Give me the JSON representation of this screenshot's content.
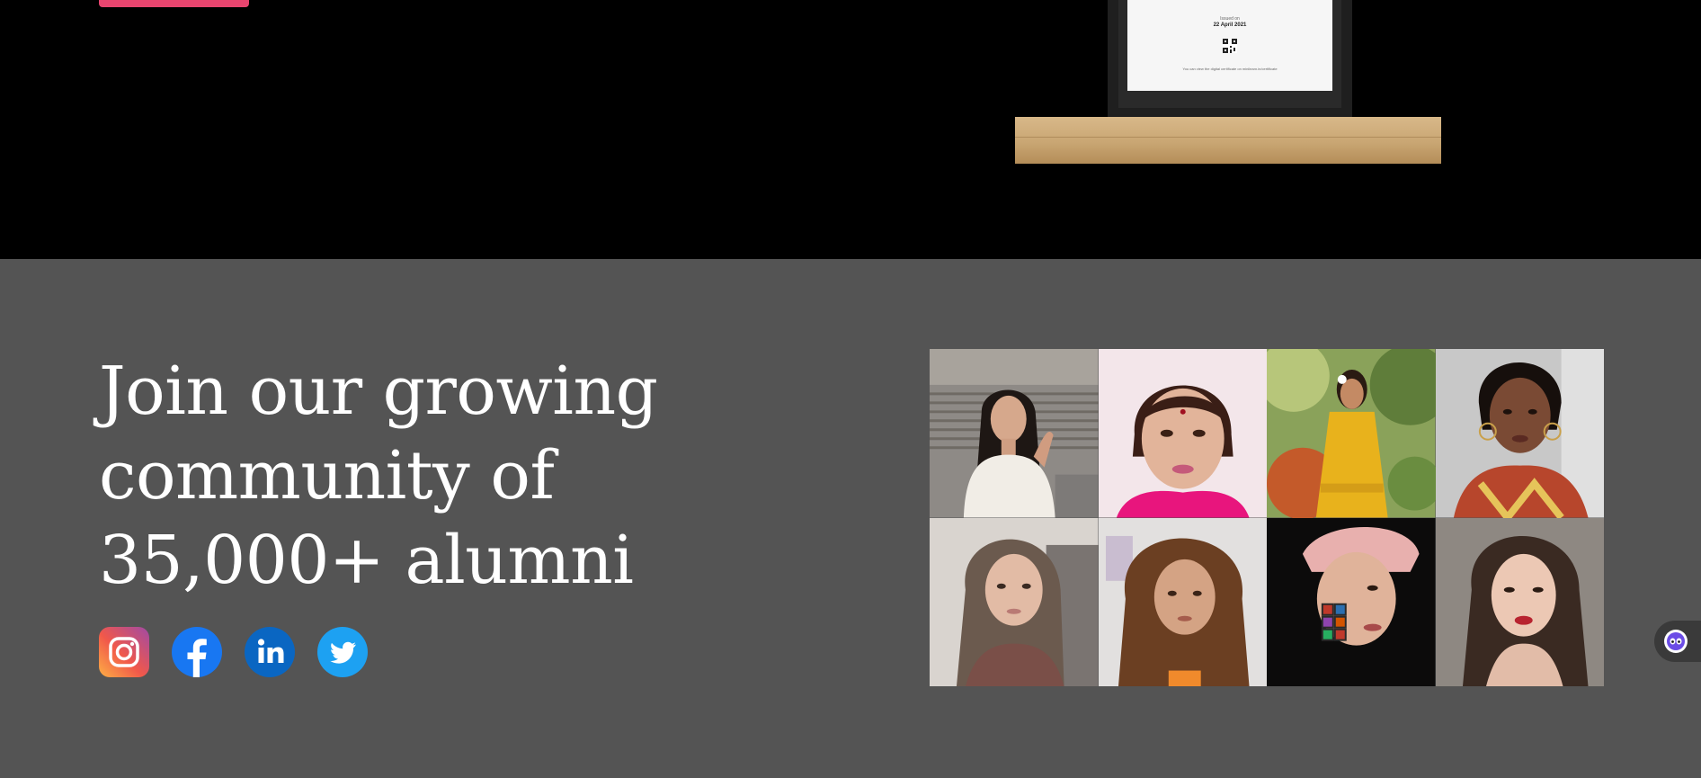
{
  "certificate": {
    "issued_label": "Issued on",
    "issued_date": "22 April 2021",
    "footer_text": "You can view the digital certificate on minilearn.in/certificate"
  },
  "community": {
    "heading_lines": [
      "Join our growing",
      "community of",
      "35,000+ alumni"
    ]
  },
  "social": [
    {
      "name": "instagram-icon",
      "color": "#d6249f"
    },
    {
      "name": "facebook-icon",
      "color": "#1877f2"
    },
    {
      "name": "linkedin-icon",
      "color": "#0a66c2"
    },
    {
      "name": "twitter-icon",
      "color": "#1da1f2"
    }
  ],
  "colors": {
    "accent": "#e8456f",
    "section_bg": "#545454",
    "hero_bg": "#000000"
  },
  "alumni_photos": [
    "alumni-photo-1",
    "alumni-photo-2",
    "alumni-photo-3",
    "alumni-photo-4",
    "alumni-photo-5",
    "alumni-photo-6",
    "alumni-photo-7",
    "alumni-photo-8"
  ]
}
